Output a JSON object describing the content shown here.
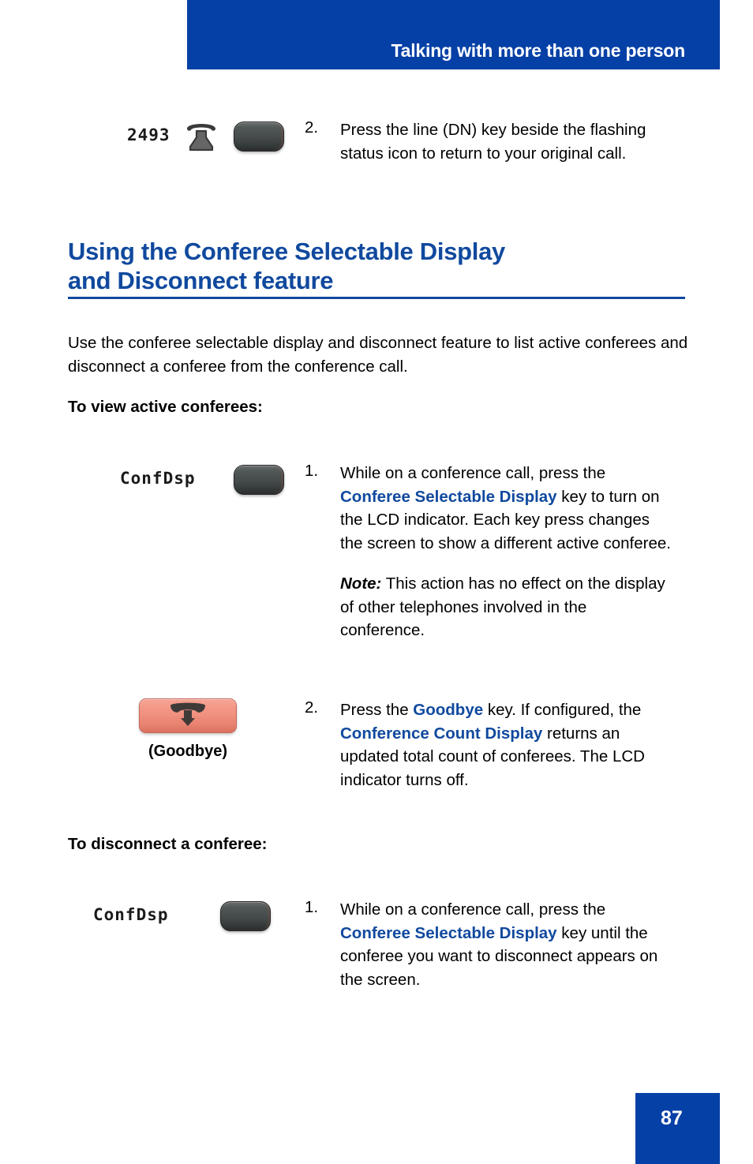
{
  "header": {
    "title": "Talking with more than one person",
    "band_color": "#0540a6"
  },
  "step_top": {
    "lcd_text": "2493",
    "number": "2.",
    "text": "Press the line (DN) key beside the flashing status icon to return to your original call."
  },
  "heading": {
    "line1": "Using the Conferee Selectable Display",
    "line2": "and Disconnect feature",
    "color": "#10499e"
  },
  "intro": {
    "paragraph": "Use the conferee selectable display and disconnect feature to list active conferees and disconnect a conferee from the conference call."
  },
  "subheading_view": "To view active conferees:",
  "subheading_disconnect": "To disconnect a conferee:",
  "view_step1": {
    "lcd_text": "ConfDsp",
    "number": "1.",
    "text_part1": "While on a conference call, press the ",
    "keyword": "Conferee Selectable Display",
    "text_part2": " key to turn on the LCD indicator. Each key press changes the screen to show a different active conferee.",
    "note_lead": "Note:",
    "note_text": " This action has no effect on the display of other telephones involved in the conference."
  },
  "view_step2": {
    "button_label": "(Goodbye)",
    "number": "2.",
    "text_part1": "Press the ",
    "keyword1": "Goodbye",
    "text_part2": " key. If configured, the ",
    "keyword2": "Conference Count Display",
    "text_part3": " returns an updated total count of conferees. The LCD indicator turns off."
  },
  "disconnect_step1": {
    "lcd_text": "ConfDsp",
    "number": "1.",
    "text_part1": "While on a conference call, press the ",
    "keyword": "Conferee Selectable Display",
    "text_part2": " key until the conferee you want to disconnect appears on the screen."
  },
  "footer": {
    "page_number": "87",
    "box_color": "#0540a6"
  }
}
